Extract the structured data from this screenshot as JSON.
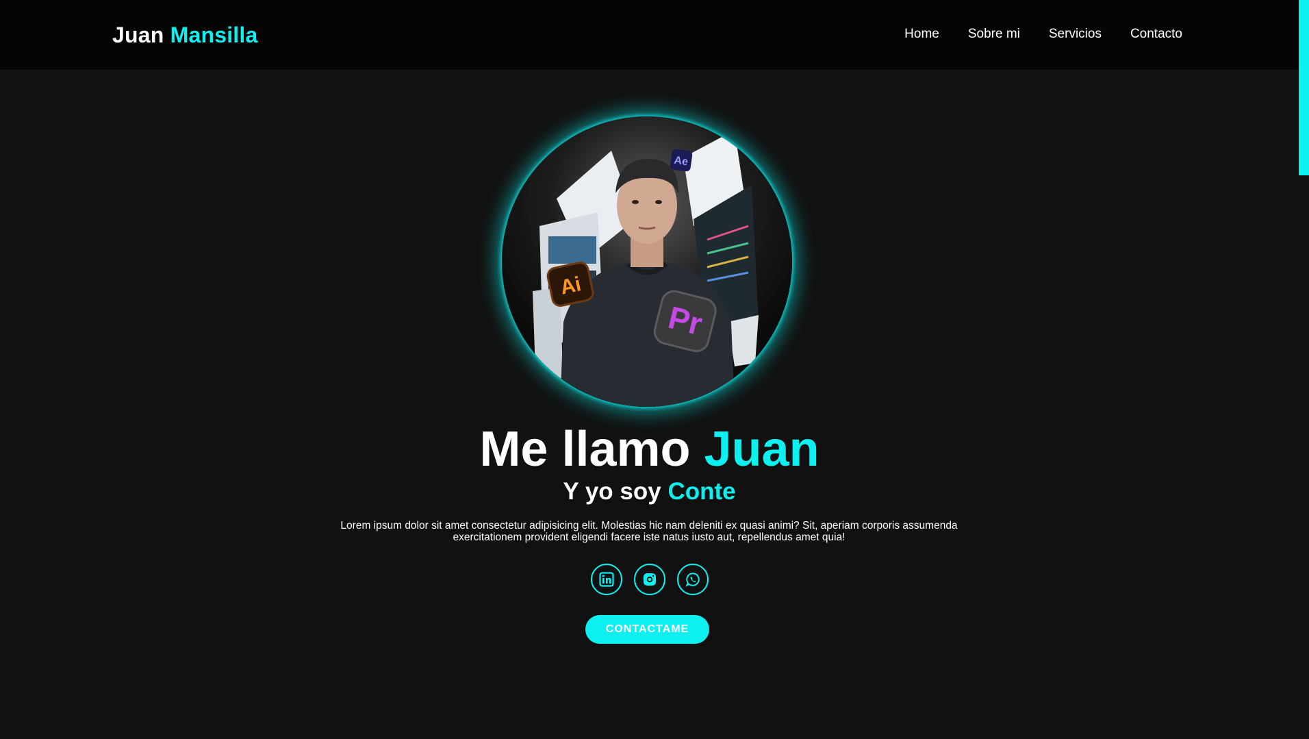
{
  "header": {
    "logo_first": "Juan",
    "logo_second": "Mansilla",
    "nav": [
      {
        "label": "Home"
      },
      {
        "label": "Sobre mi"
      },
      {
        "label": "Servicios"
      },
      {
        "label": "Contacto"
      }
    ]
  },
  "hero": {
    "title_prefix": "Me llamo ",
    "title_name": "Juan",
    "subtitle_prefix": "Y yo soy ",
    "subtitle_role": "Conte",
    "description": "Lorem ipsum dolor sit amet consectetur adipisicing elit. Molestias hic nam deleniti ex quasi animi? Sit, aperiam corporis assumenda exercitationem provident eligendi facere iste natus iusto aut, repellendus amet quia!",
    "photo_icons": [
      {
        "name": "adobe-illustrator-icon",
        "text": "Ai"
      },
      {
        "name": "adobe-premiere-icon",
        "text": "Pr"
      },
      {
        "name": "adobe-after-effects-icon",
        "text": "Ae"
      }
    ],
    "socials": [
      {
        "name": "linkedin-icon"
      },
      {
        "name": "instagram-icon"
      },
      {
        "name": "whatsapp-icon"
      }
    ],
    "cta_label": "CONTACTAME"
  },
  "colors": {
    "accent": "#0ef0f0",
    "background": "#111111",
    "header_background": "#050505"
  }
}
